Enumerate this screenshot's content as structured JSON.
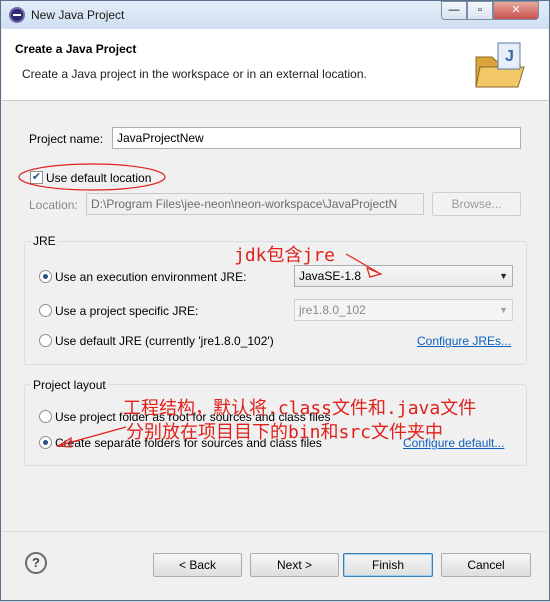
{
  "window": {
    "title": "New Java Project",
    "minimize_symbol": "—",
    "maximize_symbol": "▫",
    "close_symbol": "✕"
  },
  "header": {
    "title": "Create a Java Project",
    "description": "Create a Java project in the workspace or in an external location.",
    "icon": "java-project-folder-icon"
  },
  "project": {
    "name_label": "Project name:",
    "name_value": "JavaProjectNew",
    "use_default_location_label": "Use default location",
    "use_default_location_checked": true,
    "location_label": "Location:",
    "location_value": "D:\\Program Files\\jee-neon\\neon-workspace\\JavaProjectN",
    "browse_label": "Browse..."
  },
  "jre": {
    "group_title": "JRE",
    "option_env_label": "Use an execution environment JRE:",
    "env_value": "JavaSE-1.8",
    "option_specific_label": "Use a project specific JRE:",
    "specific_value": "jre1.8.0_102",
    "option_default_label": "Use default JRE (currently 'jre1.8.0_102')",
    "configure_link": "Configure JREs...",
    "selected": "env"
  },
  "layout": {
    "group_title": "Project layout",
    "option_root_label": "Use project folder as root for sources and class files",
    "option_separate_label": "Create separate folders for sources and class files",
    "configure_link": "Configure default...",
    "selected": "separate"
  },
  "annotations": {
    "jdk_note": "jdk包含jre",
    "structure_line1": "工程结构，默认将.class文件和.java文件",
    "structure_line2": "分别放在项目目下的bin和src文件夹中"
  },
  "footer": {
    "help_symbol": "?",
    "back_label": "< Back",
    "next_label": "Next >",
    "finish_label": "Finish",
    "cancel_label": "Cancel"
  },
  "colors": {
    "annotation_red": "#e0201a",
    "link_blue": "#1060c0"
  }
}
